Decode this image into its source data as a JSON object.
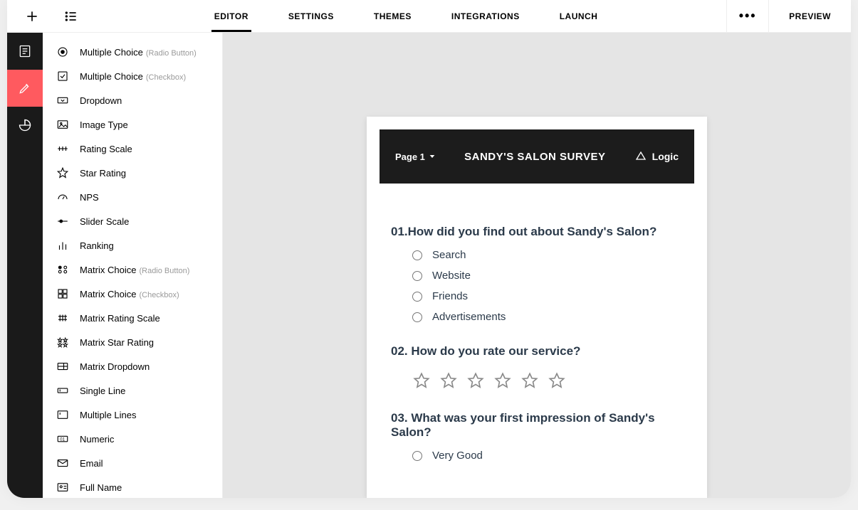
{
  "topbar": {
    "tabs": [
      "EDITOR",
      "SETTINGS",
      "THEMES",
      "INTEGRATIONS",
      "LAUNCH"
    ],
    "activeTab": 0,
    "preview": "PREVIEW"
  },
  "sidebar": {
    "items": [
      {
        "label": "Multiple Choice",
        "sublabel": "(Radio Button)"
      },
      {
        "label": "Multiple Choice",
        "sublabel": "(Checkbox)"
      },
      {
        "label": "Dropdown"
      },
      {
        "label": "Image Type"
      },
      {
        "label": "Rating Scale"
      },
      {
        "label": "Star Rating"
      },
      {
        "label": "NPS"
      },
      {
        "label": "Slider Scale"
      },
      {
        "label": "Ranking"
      },
      {
        "label": "Matrix Choice",
        "sublabel": "(Radio Button)"
      },
      {
        "label": "Matrix Choice",
        "sublabel": "(Checkbox)"
      },
      {
        "label": "Matrix Rating Scale"
      },
      {
        "label": "Matrix Star Rating"
      },
      {
        "label": "Matrix Dropdown"
      },
      {
        "label": "Single Line"
      },
      {
        "label": "Multiple Lines"
      },
      {
        "label": "Numeric"
      },
      {
        "label": "Email"
      },
      {
        "label": "Full Name"
      }
    ]
  },
  "card": {
    "pageLabel": "Page 1",
    "title": "SANDY'S SALON SURVEY",
    "logic": "Logic"
  },
  "questions": {
    "q1": {
      "title": "01.How did you find out about Sandy's Salon?",
      "options": [
        "Search",
        "Website",
        "Friends",
        "Advertisements"
      ]
    },
    "q2": {
      "title": "02. How do you rate our service?",
      "stars": 6
    },
    "q3": {
      "title": "03. What was your first impression of Sandy's Salon?",
      "options": [
        "Very Good"
      ]
    }
  },
  "colors": {
    "accent": "#ff5a5f",
    "dark": "#1a1a1a"
  }
}
